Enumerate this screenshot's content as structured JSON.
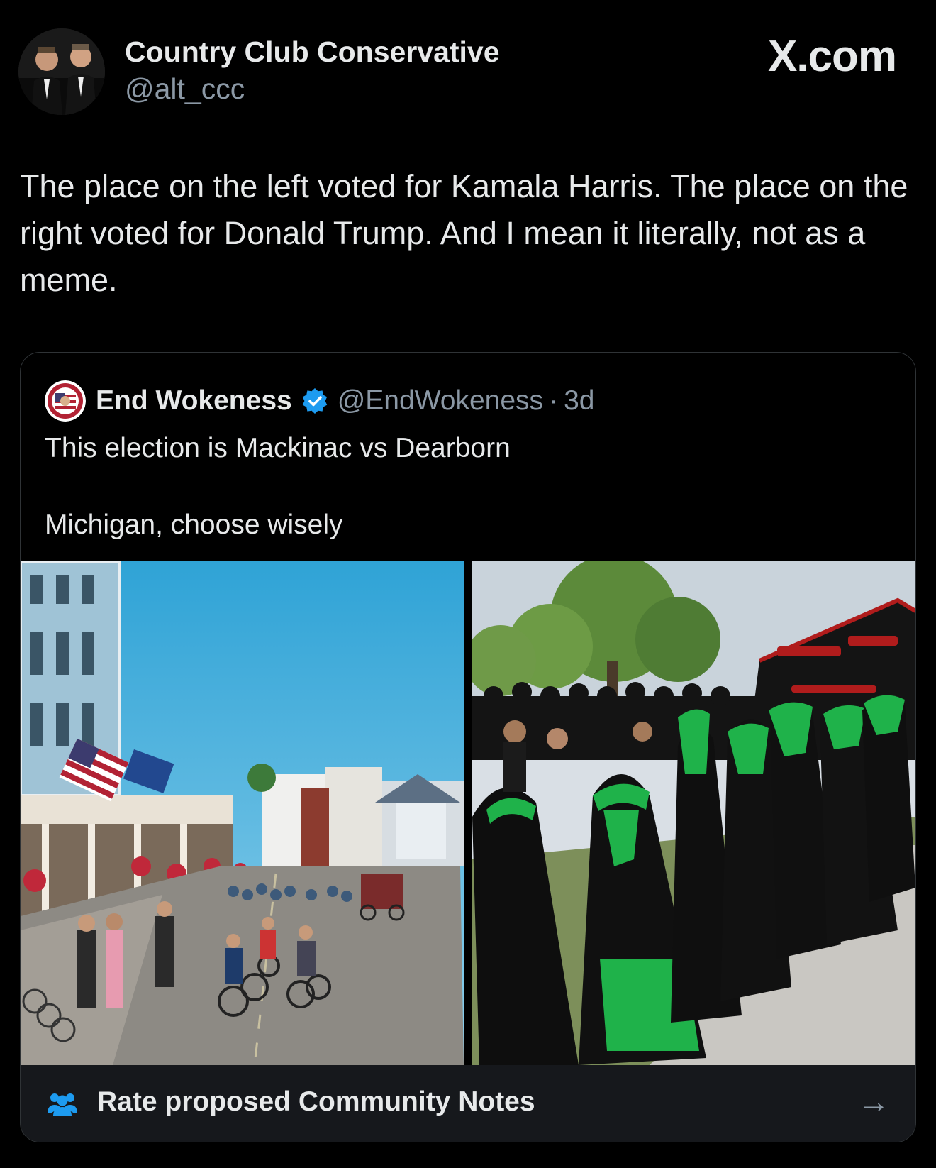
{
  "header": {
    "display_name": "Country Club Conservative",
    "handle": "@alt_ccc",
    "site_label": "X.com"
  },
  "tweet": {
    "text": "The place on the left voted for Kamala Harris. The place on the right voted for Donald Trump. And I mean it literally, not as a meme."
  },
  "quote": {
    "display_name": "End Wokeness",
    "handle": "@EndWokeness",
    "separator": "·",
    "time": "3d",
    "text_line1": "This election is Mackinac vs Dearborn",
    "text_line2": "Michigan, choose wisely",
    "photos": [
      {
        "icon": "street-photo"
      },
      {
        "icon": "procession-photo"
      }
    ]
  },
  "community_notes": {
    "label": "Rate proposed Community Notes",
    "icon": "people-icon",
    "arrow_icon": "arrow-right-icon"
  },
  "colors": {
    "background": "#000000",
    "text": "#e7e9ea",
    "muted": "#8b98a5",
    "verified": "#1d9bf0",
    "notes_bar": "#16181c",
    "notes_icon": "#1d9bf0"
  }
}
